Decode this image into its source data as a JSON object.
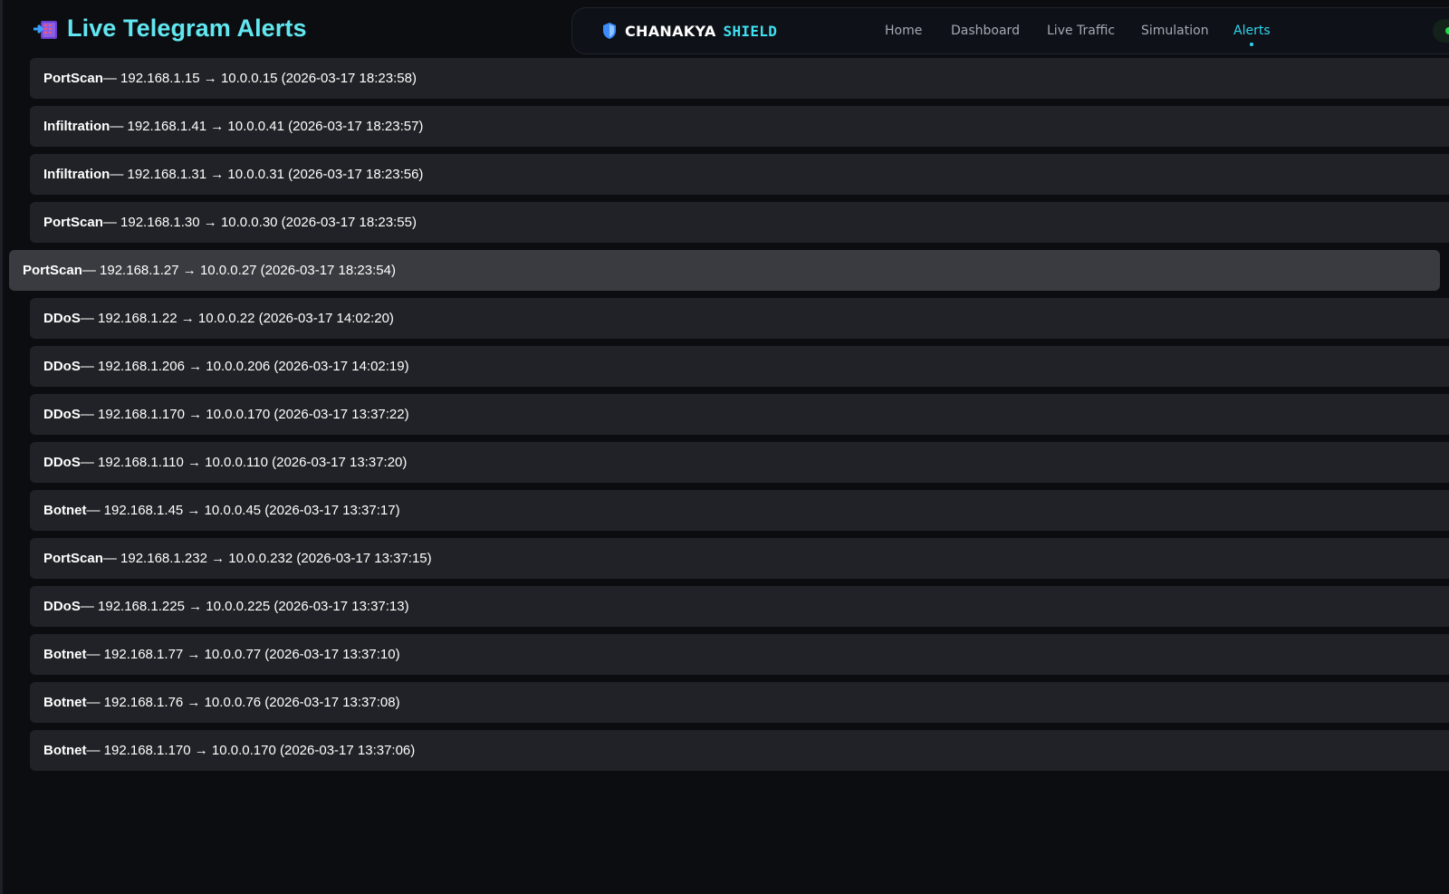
{
  "page": {
    "title": "Live Telegram Alerts",
    "title_icon": "incoming-envelope-icon"
  },
  "navbar": {
    "brand_icon": "shield-icon",
    "brand_part1": "CHANAKYA",
    "brand_part2": "SHIELD",
    "links": [
      {
        "label": "Home",
        "active": false
      },
      {
        "label": "Dashboard",
        "active": false
      },
      {
        "label": "Live Traffic",
        "active": false
      },
      {
        "label": "Simulation",
        "active": false
      },
      {
        "label": "Alerts",
        "active": true
      }
    ],
    "status_indicator_color": "#27d64d"
  },
  "colors": {
    "accent": "#2fd6ee",
    "title": "#62e7f0",
    "row_bg": "#212227",
    "row_highlight_bg": "#3a3b40",
    "page_bg": "#0b0d11"
  },
  "alerts": [
    {
      "type": "PortScan",
      "detail": " — 192.168.1.15 → 10.0.0.15 (2026-03-17 18:23:58)",
      "highlighted": false
    },
    {
      "type": "Infiltration",
      "detail": " — 192.168.1.41 → 10.0.0.41 (2026-03-17 18:23:57)",
      "highlighted": false
    },
    {
      "type": "Infiltration",
      "detail": " — 192.168.1.31 → 10.0.0.31 (2026-03-17 18:23:56)",
      "highlighted": false
    },
    {
      "type": "PortScan",
      "detail": " — 192.168.1.30 → 10.0.0.30 (2026-03-17 18:23:55)",
      "highlighted": false
    },
    {
      "type": "PortScan",
      "detail": " — 192.168.1.27 → 10.0.0.27 (2026-03-17 18:23:54)",
      "highlighted": true
    },
    {
      "type": "DDoS",
      "detail": " — 192.168.1.22 → 10.0.0.22 (2026-03-17 14:02:20)",
      "highlighted": false
    },
    {
      "type": "DDoS",
      "detail": " — 192.168.1.206 → 10.0.0.206 (2026-03-17 14:02:19)",
      "highlighted": false
    },
    {
      "type": "DDoS",
      "detail": " — 192.168.1.170 → 10.0.0.170 (2026-03-17 13:37:22)",
      "highlighted": false
    },
    {
      "type": "DDoS",
      "detail": " — 192.168.1.110 → 10.0.0.110 (2026-03-17 13:37:20)",
      "highlighted": false
    },
    {
      "type": "Botnet",
      "detail": " — 192.168.1.45 → 10.0.0.45 (2026-03-17 13:37:17)",
      "highlighted": false
    },
    {
      "type": "PortScan",
      "detail": " — 192.168.1.232 → 10.0.0.232 (2026-03-17 13:37:15)",
      "highlighted": false
    },
    {
      "type": "DDoS",
      "detail": " — 192.168.1.225 → 10.0.0.225 (2026-03-17 13:37:13)",
      "highlighted": false
    },
    {
      "type": "Botnet",
      "detail": " — 192.168.1.77 → 10.0.0.77 (2026-03-17 13:37:10)",
      "highlighted": false
    },
    {
      "type": "Botnet",
      "detail": " — 192.168.1.76 → 10.0.0.76 (2026-03-17 13:37:08)",
      "highlighted": false
    },
    {
      "type": "Botnet",
      "detail": " — 192.168.1.170 → 10.0.0.170 (2026-03-17 13:37:06)",
      "highlighted": false
    }
  ]
}
